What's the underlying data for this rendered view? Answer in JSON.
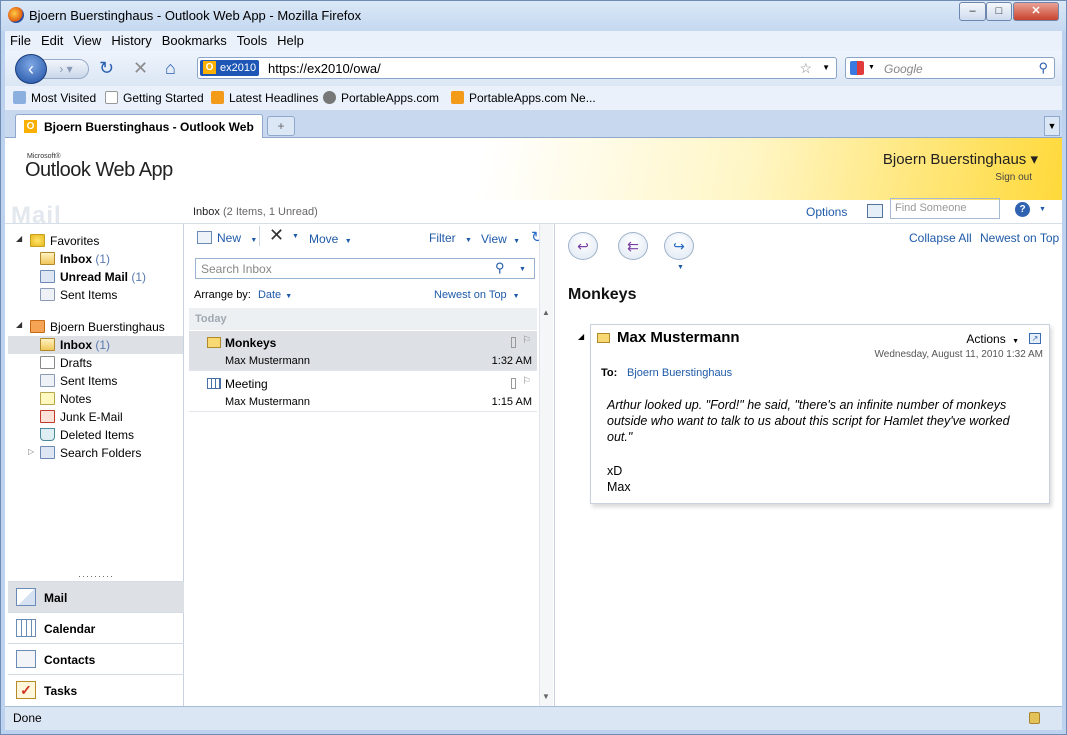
{
  "window": {
    "title": "Bjoern Buerstinghaus - Outlook Web App - Mozilla Firefox",
    "minimize": "–",
    "maximize": "□",
    "close": "✕"
  },
  "menu": [
    "File",
    "Edit",
    "View",
    "History",
    "Bookmarks",
    "Tools",
    "Help"
  ],
  "nav": {
    "url_identity": "ex2010",
    "url": "https://ex2010/owa/",
    "search_placeholder": "Google"
  },
  "bookmarks": [
    "Most Visited",
    "Getting Started",
    "Latest Headlines",
    "PortableApps.com",
    "PortableApps.com Ne..."
  ],
  "tabs": [
    {
      "label": "Bjoern Buerstinghaus - Outlook Web ..."
    }
  ],
  "owa": {
    "ms_label": "Microsoft®",
    "logo": "Outlook Web App",
    "user": "Bjoern Buerstinghaus ▾",
    "sign_out": "Sign out",
    "section": "Mail",
    "options": "Options",
    "find_someone": "Find Someone"
  },
  "folders": {
    "favorites_label": "Favorites",
    "favorites": [
      {
        "label": "Inbox",
        "count": "(1)",
        "bold": true
      },
      {
        "label": "Unread Mail",
        "count": "(1)",
        "bold": true
      },
      {
        "label": "Sent Items",
        "count": "",
        "bold": false
      }
    ],
    "mailbox_label": "Bjoern Buerstinghaus",
    "mailbox": [
      {
        "label": "Inbox",
        "count": "(1)",
        "bold": true
      },
      {
        "label": "Drafts",
        "count": ""
      },
      {
        "label": "Sent Items",
        "count": ""
      },
      {
        "label": "Notes",
        "count": ""
      },
      {
        "label": "Junk E-Mail",
        "count": ""
      },
      {
        "label": "Deleted Items",
        "count": ""
      },
      {
        "label": "Search Folders",
        "count": ""
      }
    ]
  },
  "modules": [
    "Mail",
    "Calendar",
    "Contacts",
    "Tasks"
  ],
  "list": {
    "folder": "Inbox",
    "summary": "(2 Items,  1 Unread)",
    "new": "New",
    "move": "Move",
    "filter": "Filter",
    "view": "View",
    "search_placeholder": "Search Inbox",
    "arrange_by": "Arrange by:",
    "arrange_field": "Date",
    "sort": "Newest on Top",
    "group": "Today",
    "messages": [
      {
        "subject": "Monkeys",
        "from": "Max Mustermann",
        "time": "1:32 AM",
        "type": "mail",
        "unread": true
      },
      {
        "subject": "Meeting",
        "from": "Max Mustermann",
        "time": "1:15 AM",
        "type": "meeting",
        "unread": false
      }
    ]
  },
  "reading": {
    "collapse_all": "Collapse All",
    "newest_on_top": "Newest on Top",
    "subject": "Monkeys",
    "sender": "Max Mustermann",
    "actions": "Actions",
    "date": "Wednesday, August 11, 2010 1:32 AM",
    "to_label": "To:",
    "to": "Bjoern Buerstinghaus",
    "body_italic": "Arthur looked up. \"Ford!\" he said, \"there's an infinite number of monkeys outside who want to talk to us about this script for Hamlet they've worked out.\"",
    "body_line1": "xD",
    "body_line2": "Max"
  },
  "status": "Done"
}
